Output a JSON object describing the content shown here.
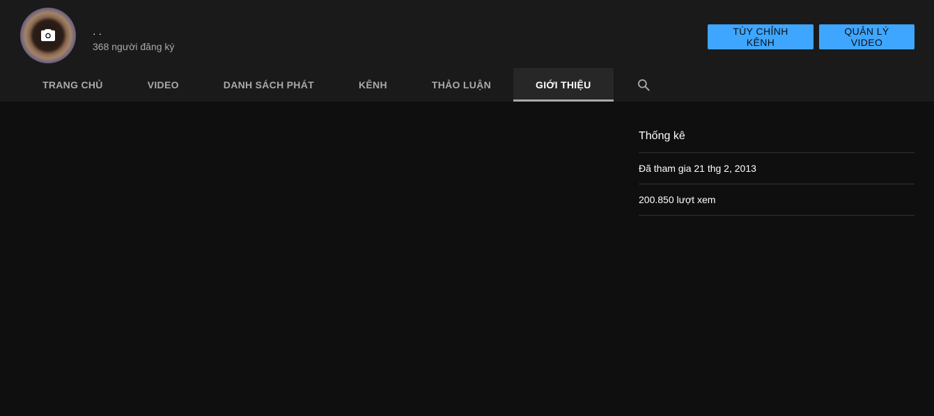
{
  "channel": {
    "name": "· ·",
    "subscribers": "368 người đăng ký",
    "avatar_icon": "camera-icon"
  },
  "buttons": {
    "customize": "TÙY CHỈNH KÊNH",
    "manage": "QUẢN LÝ VIDEO"
  },
  "tabs": [
    {
      "label": "TRANG CHỦ",
      "active": false
    },
    {
      "label": "VIDEO",
      "active": false
    },
    {
      "label": "DANH SÁCH PHÁT",
      "active": false
    },
    {
      "label": "KÊNH",
      "active": false
    },
    {
      "label": "THẢO LUẬN",
      "active": false
    },
    {
      "label": "GIỚI THIỆU",
      "active": true
    }
  ],
  "search_icon": "search-icon",
  "stats": {
    "title": "Thống kê",
    "joined": "Đã tham gia 21 thg 2, 2013",
    "views": "200.850 lượt xem"
  },
  "colors": {
    "background": "#0f0f0f",
    "header": "#1a1a1a",
    "accent": "#3ea6ff",
    "text_secondary": "#aaaaaa"
  }
}
